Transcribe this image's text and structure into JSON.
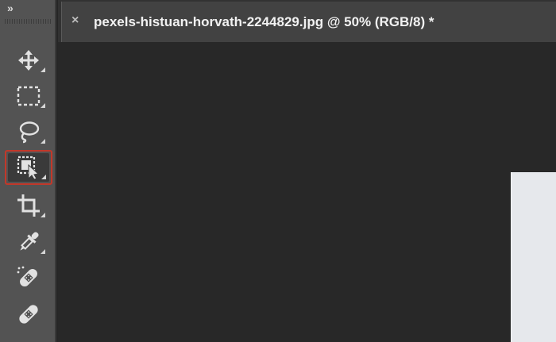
{
  "toolbar": {
    "collapse_label": "»",
    "tools": [
      {
        "name": "move-tool",
        "icon": "move-icon"
      },
      {
        "name": "rectangular-marquee-tool",
        "icon": "marquee-icon"
      },
      {
        "name": "lasso-tool",
        "icon": "lasso-icon"
      },
      {
        "name": "object-selection-tool",
        "icon": "object-selection-icon",
        "selected": true
      },
      {
        "name": "crop-tool",
        "icon": "crop-icon"
      },
      {
        "name": "eyedropper-tool",
        "icon": "eyedropper-icon"
      },
      {
        "name": "spot-healing-brush-tool",
        "icon": "spot-healing-icon"
      },
      {
        "name": "healing-brush-tool",
        "icon": "bandage-icon"
      }
    ]
  },
  "document": {
    "close_label": "×",
    "tab_title": "pexels-histuan-horvath-2244829.jpg @ 50% (RGB/8) *"
  },
  "colors": {
    "selection_highlight": "#c2382a",
    "toolbar_bg": "#535353",
    "canvas_bg": "#282828"
  }
}
